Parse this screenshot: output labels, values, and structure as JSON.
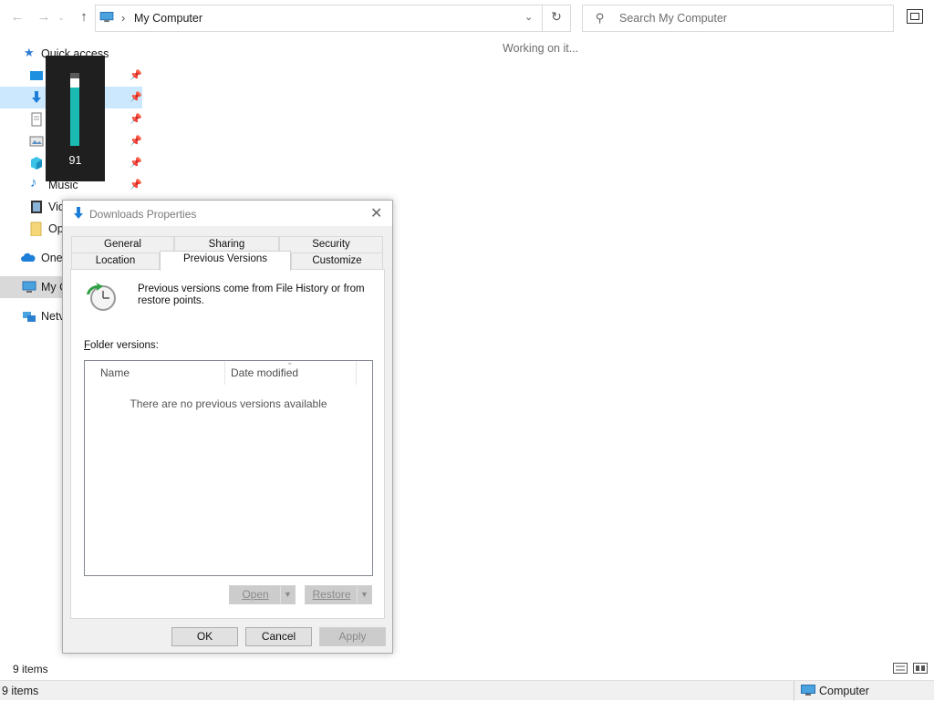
{
  "toolbar": {
    "back_icon": "arrow-left",
    "forward_icon": "arrow-right",
    "up_icon": "arrow-up"
  },
  "address_bar": {
    "path": "My Computer",
    "separator": "›"
  },
  "search": {
    "placeholder": "Search My Computer"
  },
  "main": {
    "status_text": "Working on it..."
  },
  "sidebar": {
    "items": [
      {
        "label": "Quick access",
        "pinned": false
      },
      {
        "label": "Desktop",
        "pinned": true
      },
      {
        "label": "Downloads",
        "pinned": true
      },
      {
        "label": "Documents",
        "pinned": true
      },
      {
        "label": "Pictures",
        "pinned": true
      },
      {
        "label": "3D Objects",
        "pinned": true
      },
      {
        "label": "Music",
        "pinned": true
      },
      {
        "label": "Vid",
        "pinned": false
      },
      {
        "label": "Op",
        "pinned": false
      },
      {
        "label": "OneI",
        "pinned": false
      },
      {
        "label": "My C",
        "pinned": false
      },
      {
        "label": "Netv",
        "pinned": false
      }
    ]
  },
  "volume_osd": {
    "value": "91",
    "level": 0.91,
    "accent": "#1bbab2"
  },
  "dialog": {
    "title": "Downloads Properties",
    "tabs_row1": [
      "General",
      "Sharing",
      "Security"
    ],
    "tabs_row2": [
      "Location",
      "Previous Versions",
      "Customize"
    ],
    "active_tab": "Previous Versions",
    "description": "Previous versions come from File History or from restore points.",
    "folder_versions_label_prefix": "F",
    "folder_versions_label_rest": "older versions:",
    "columns": [
      "Name",
      "Date modified"
    ],
    "empty_message": "There are no previous versions available",
    "open_button": "Open",
    "restore_button": "Restore",
    "ok_button": "OK",
    "cancel_button": "Cancel",
    "apply_button": "Apply"
  },
  "statusbar": {
    "item_count": "9 items"
  },
  "bottom_status": {
    "item_count": "9 items",
    "zone": "Computer"
  },
  "colors": {
    "selection": "#cce8ff",
    "accent_blue": "#0078d7"
  }
}
